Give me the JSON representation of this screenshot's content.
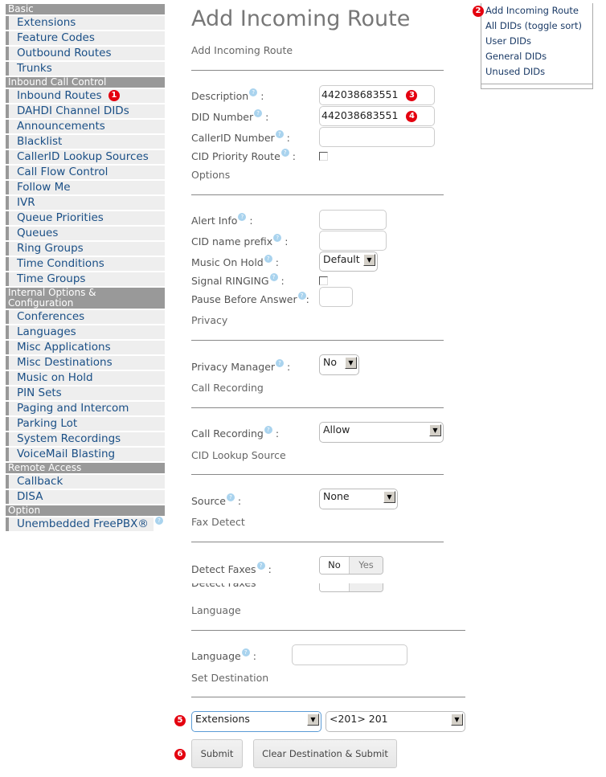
{
  "sidebar": {
    "sections": [
      {
        "header": "Basic",
        "items": [
          "Extensions",
          "Feature Codes",
          "Outbound Routes",
          "Trunks"
        ]
      },
      {
        "header": "Inbound Call Control",
        "items": [
          "Inbound Routes",
          "DAHDI Channel DIDs",
          "Announcements",
          "Blacklist",
          "CallerID Lookup Sources",
          "Call Flow Control",
          "Follow Me",
          "IVR",
          "Queue Priorities",
          "Queues",
          "Ring Groups",
          "Time Conditions",
          "Time Groups"
        ]
      },
      {
        "header": "Internal Options & Configuration",
        "items": [
          "Conferences",
          "Languages",
          "Misc Applications",
          "Misc Destinations",
          "Music on Hold",
          "PIN Sets",
          "Paging and Intercom",
          "Parking Lot",
          "System Recordings",
          "VoiceMail Blasting"
        ]
      },
      {
        "header": "Remote Access",
        "items": [
          "Callback",
          "DISA"
        ]
      },
      {
        "header": "Option",
        "items": [
          "Unembedded FreePBX®"
        ]
      }
    ]
  },
  "badges": {
    "b1": "1",
    "b2": "2",
    "b3": "3",
    "b4": "4",
    "b5": "5",
    "b6": "6"
  },
  "help_glyph": "?",
  "right_nav": {
    "items": [
      "Add Incoming Route",
      "All DIDs (toggle sort)",
      "User DIDs",
      "General DIDs",
      "Unused DIDs"
    ]
  },
  "main": {
    "title": "Add Incoming Route",
    "subtitle": "Add Incoming Route",
    "fields": {
      "description": {
        "label": "Description",
        "value": "442038683551"
      },
      "did_number": {
        "label": "DID Number",
        "value": "442038683551"
      },
      "callerid_number": {
        "label": "CallerID Number",
        "value": ""
      },
      "cid_priority": {
        "label": "CID Priority Route",
        "checked": false
      }
    },
    "options_section": "Options",
    "options": {
      "alert_info": {
        "label": "Alert Info",
        "value": ""
      },
      "cid_prefix": {
        "label": "CID name prefix",
        "value": ""
      },
      "moh": {
        "label": "Music On Hold",
        "value": "Default"
      },
      "signal_ringing": {
        "label": "Signal RINGING",
        "checked": false
      },
      "pause": {
        "label": "Pause Before Answer",
        "value": ""
      }
    },
    "privacy_section": "Privacy",
    "privacy_manager": {
      "label": "Privacy Manager",
      "value": "No"
    },
    "call_recording_section": "Call Recording",
    "call_recording": {
      "label": "Call Recording",
      "value": "Allow"
    },
    "cid_lookup_section": "CID Lookup Source",
    "source": {
      "label": "Source",
      "value": "None"
    },
    "fax_section": "Fax Detect",
    "detect_faxes": {
      "label": "Detect Faxes",
      "options": [
        "No",
        "Yes"
      ],
      "selected": "No"
    },
    "language_section": "Language",
    "language": {
      "label": "Language",
      "value": ""
    },
    "destination_section": "Set Destination",
    "destination": {
      "type": "Extensions",
      "target": "<201> 201"
    },
    "submit_label": "Submit",
    "clear_submit_label": "Clear Destination & Submit",
    "colon": ":"
  }
}
